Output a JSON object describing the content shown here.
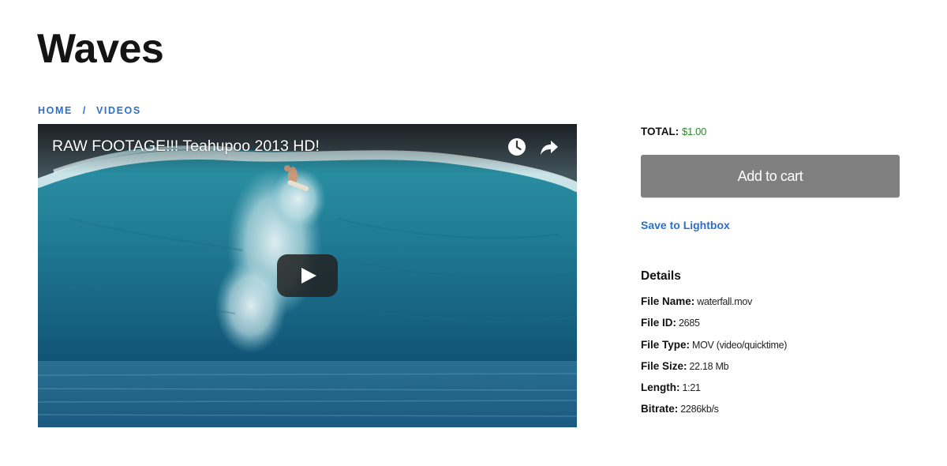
{
  "page": {
    "title": "Waves"
  },
  "breadcrumb": {
    "home": "HOME",
    "separator": "/",
    "current": "VIDEOS"
  },
  "video": {
    "title": "RAW FOOTAGE!!! Teahupoo 2013 HD!",
    "icons": [
      "clock-icon",
      "share-icon",
      "play-icon"
    ]
  },
  "purchase": {
    "total_label": "TOTAL:",
    "price": "$1.00",
    "add_to_cart": "Add to cart",
    "save_to_lightbox": "Save to Lightbox"
  },
  "details": {
    "heading": "Details",
    "items": [
      {
        "label": "File Name:",
        "value": "waterfall.mov"
      },
      {
        "label": "File ID:",
        "value": "2685"
      },
      {
        "label": "File Type:",
        "value": "MOV (video/quicktime)"
      },
      {
        "label": "File Size:",
        "value": "22.18 Mb"
      },
      {
        "label": "Length:",
        "value": "1:21"
      },
      {
        "label": "Bitrate:",
        "value": "2286kb/s"
      }
    ]
  },
  "colors": {
    "link": "#2b6fc9",
    "price": "#2a8a2a",
    "button": "#808080"
  }
}
